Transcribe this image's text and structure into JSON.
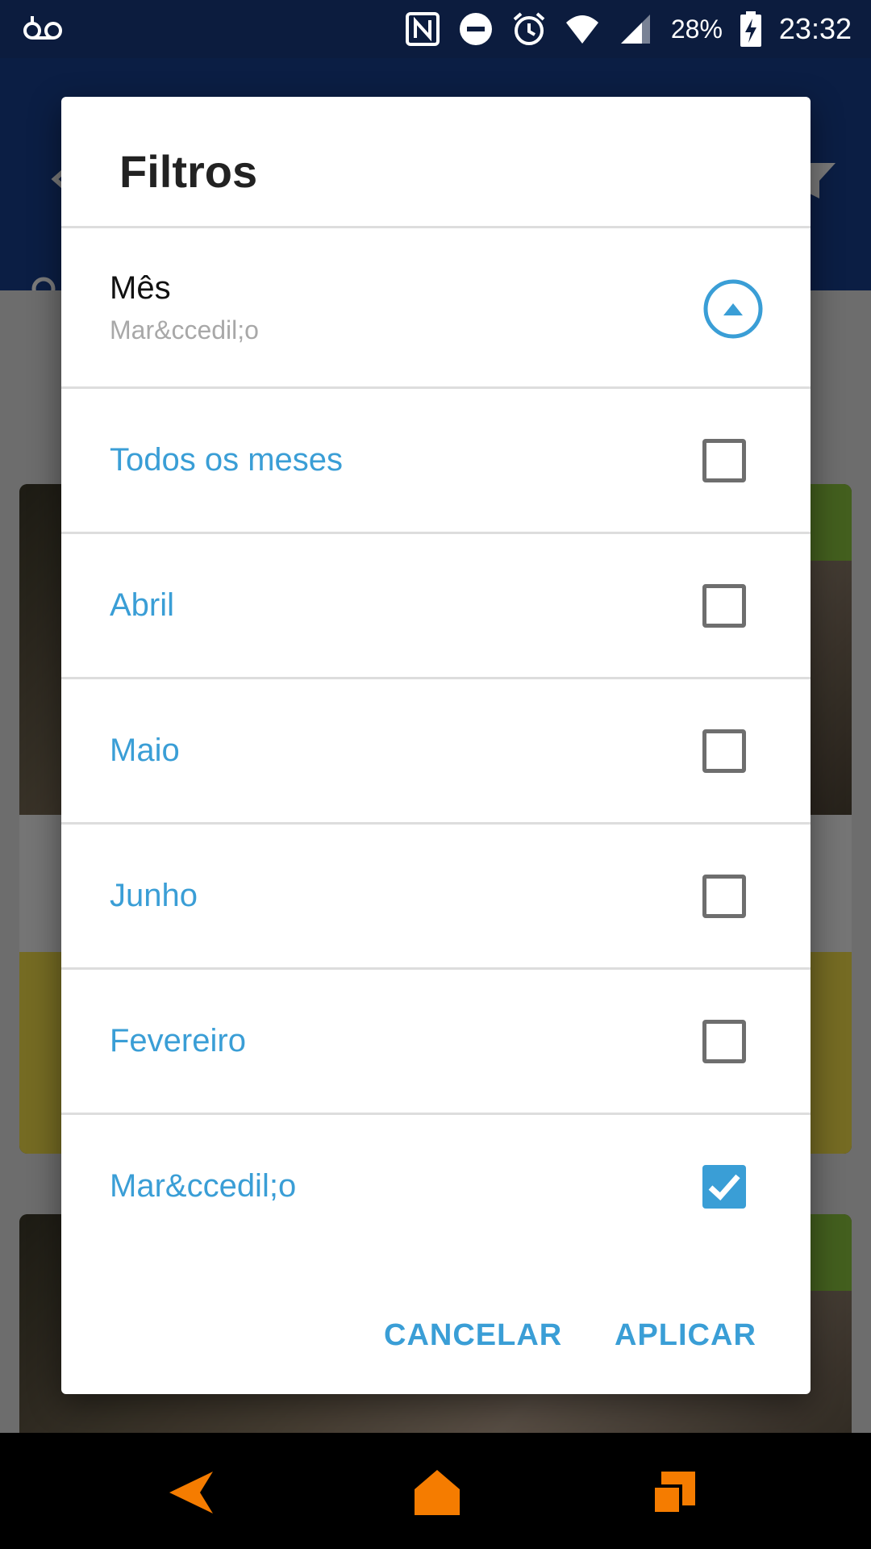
{
  "status_bar": {
    "battery": "28%",
    "time": "23:32",
    "icons": [
      "voicemail-icon",
      "nfc-icon",
      "do-not-disturb-icon",
      "alarm-icon",
      "wifi-icon",
      "signal-icon",
      "battery-charging-icon"
    ]
  },
  "dialog": {
    "title": "Filtros",
    "dropdown": {
      "label": "Mês",
      "value": "Mar&ccedil;o",
      "toggle_icon": "chevron-up-circle-icon"
    },
    "options": [
      {
        "label": "Todos os meses",
        "checked": false
      },
      {
        "label": "Abril",
        "checked": false
      },
      {
        "label": "Maio",
        "checked": false
      },
      {
        "label": "Junho",
        "checked": false
      },
      {
        "label": "Fevereiro",
        "checked": false
      },
      {
        "label": "Mar&ccedil;o",
        "checked": true
      }
    ],
    "buttons": {
      "cancel": "CANCELAR",
      "apply": "APLICAR"
    }
  },
  "nav_bar": {
    "icons": [
      "back-icon",
      "home-icon",
      "recents-icon"
    ]
  },
  "colors": {
    "accent": "#3a9ed6",
    "header": "#17408f",
    "nav_accent": "#f57c00"
  }
}
